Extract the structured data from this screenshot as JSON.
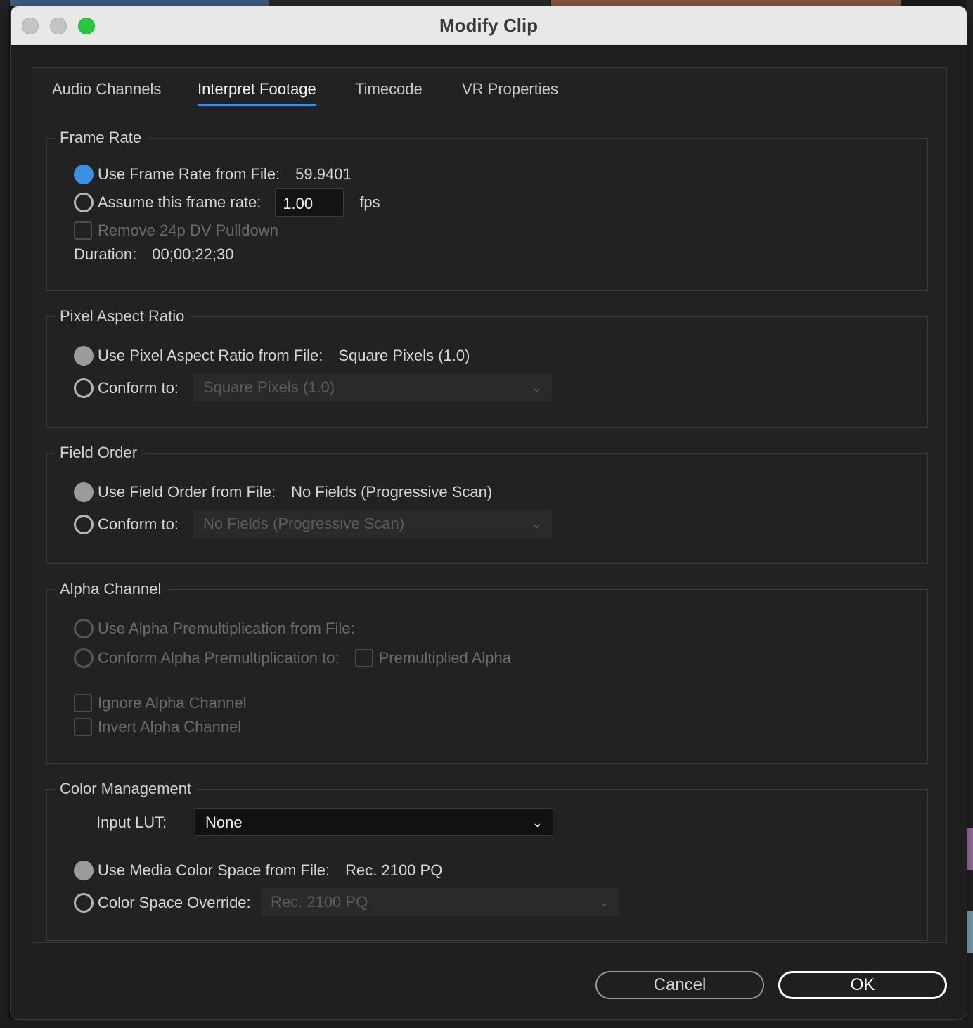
{
  "window": {
    "title": "Modify Clip"
  },
  "tabs": [
    {
      "label": "Audio Channels"
    },
    {
      "label": "Interpret Footage"
    },
    {
      "label": "Timecode"
    },
    {
      "label": "VR Properties"
    }
  ],
  "frame_rate": {
    "legend": "Frame Rate",
    "use_file_label": "Use Frame Rate from File:",
    "use_file_value": "59.9401",
    "assume_label": "Assume this frame rate:",
    "assume_value": "1.00",
    "assume_unit": "fps",
    "pulldown_label": "Remove 24p DV Pulldown",
    "duration_label": "Duration:",
    "duration_value": "00;00;22;30"
  },
  "pixel_aspect": {
    "legend": "Pixel Aspect Ratio",
    "use_file_label": "Use Pixel Aspect Ratio from File:",
    "use_file_value": "Square Pixels (1.0)",
    "conform_label": "Conform to:",
    "conform_value": "Square Pixels (1.0)"
  },
  "field_order": {
    "legend": "Field Order",
    "use_file_label": "Use Field Order from File:",
    "use_file_value": "No Fields (Progressive Scan)",
    "conform_label": "Conform to:",
    "conform_value": "No Fields (Progressive Scan)"
  },
  "alpha": {
    "legend": "Alpha Channel",
    "use_file_label": "Use Alpha Premultiplication from File:",
    "conform_label": "Conform Alpha Premultiplication to:",
    "premult_label": "Premultiplied Alpha",
    "ignore_label": "Ignore Alpha Channel",
    "invert_label": "Invert Alpha Channel"
  },
  "color": {
    "legend": "Color Management",
    "lut_label": "Input LUT:",
    "lut_value": "None",
    "use_file_label": "Use Media Color Space from File:",
    "use_file_value": "Rec. 2100 PQ",
    "override_label": "Color Space Override:",
    "override_value": "Rec. 2100 PQ"
  },
  "buttons": {
    "cancel": "Cancel",
    "ok": "OK"
  },
  "colors": {
    "accent": "#3b8fe5",
    "background": "#222222",
    "titlebar": "#e8e8e8"
  },
  "icons": [
    "close-icon",
    "minimize-icon",
    "zoom-icon",
    "chevron-down-icon"
  ]
}
